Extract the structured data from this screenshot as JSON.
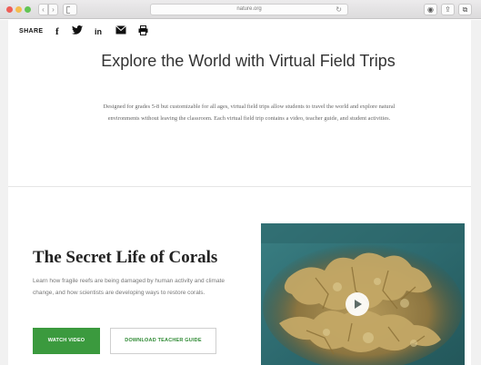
{
  "browser": {
    "url": "nature.org",
    "reload_icon": "reload-icon",
    "nav_back_icon": "chevron-left-icon",
    "nav_fwd_icon": "chevron-right-icon",
    "toolbar_icons": [
      "extension-icon",
      "share-icon",
      "tabs-icon"
    ]
  },
  "share": {
    "label": "SHARE",
    "icons": [
      "facebook-icon",
      "twitter-icon",
      "linkedin-icon",
      "email-icon",
      "print-icon"
    ],
    "facebook_glyph": "f",
    "linkedin_glyph": "in"
  },
  "hero": {
    "title": "Explore the World with Virtual Field Trips",
    "description": "Designed for grades 5-8 but customizable for all ages, virtual field trips allow students to travel the world and explore natural environments without leaving the classroom. Each virtual field trip contains a video, teacher guide, and student activities."
  },
  "feature": {
    "title": "The Secret Life of Corals",
    "description": "Learn how fragile reefs are being damaged by human activity and climate change, and how scientists are developing ways to restore corals.",
    "watch_label": "WATCH VIDEO",
    "download_label": "DOWNLOAD TEACHER GUIDE"
  },
  "colors": {
    "accent_green": "#3b9a3e",
    "download_text": "#2f8a34",
    "water_teal": "#2f6f74"
  }
}
